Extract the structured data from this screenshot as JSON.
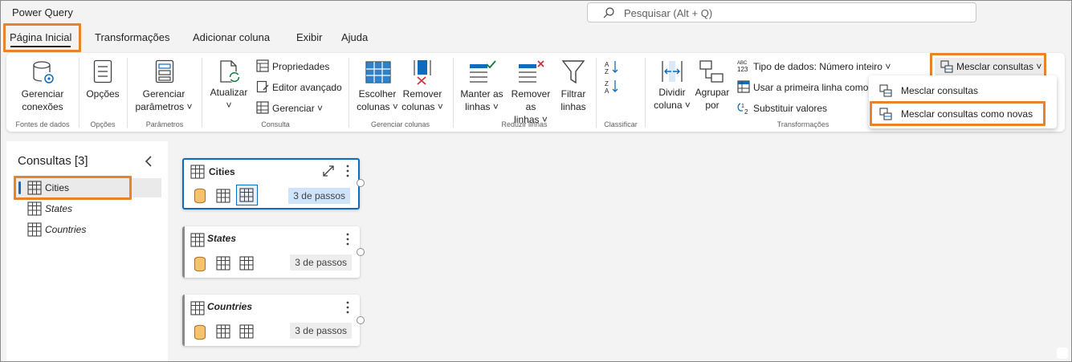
{
  "app": {
    "title": "Power Query"
  },
  "search": {
    "placeholder": "Pesquisar (Alt + Q)"
  },
  "tabs": [
    {
      "label": "Página Inicial",
      "active": true
    },
    {
      "label": "Transformações"
    },
    {
      "label": "Adicionar coluna"
    },
    {
      "label": "Exibir"
    },
    {
      "label": "Ajuda"
    }
  ],
  "ribbon": {
    "fontes": {
      "btn1": "Gerenciar",
      "btn2": "conexões",
      "group": "Fontes de dados"
    },
    "opcoes": {
      "btn": "Opções",
      "group": "Opções"
    },
    "parametros": {
      "btn1": "Gerenciar",
      "btn2": "parâmetros",
      "group": "Parâmetros"
    },
    "consulta": {
      "atualizar": "Atualizar",
      "propriedades": "Propriedades",
      "editor": "Editor avançado",
      "gerenciar": "Gerenciar",
      "group": "Consulta"
    },
    "colunas": {
      "escolher1": "Escolher",
      "escolher2": "colunas",
      "remover1": "Remover",
      "remover2": "colunas",
      "group": "Gerenciar colunas"
    },
    "linhas": {
      "manter1": "Manter as",
      "manter2": "linhas",
      "remover1": "Remover as",
      "remover2": "linhas",
      "filtrar1": "Filtrar",
      "filtrar2": "linhas",
      "group": "Reduzir linhas"
    },
    "classificar": {
      "group": "Classificar"
    },
    "transf": {
      "dividir1": "Dividir",
      "dividir2": "coluna",
      "agrupar1": "Agrupar",
      "agrupar2": "por",
      "tipo": "Tipo de dados: Número inteiro",
      "primeira": "Usar a primeira linha como",
      "substituir": "Substituir valores",
      "group": "Transformações"
    },
    "mesclar": {
      "label": "Mesclar consultas"
    }
  },
  "dropdown": {
    "items": [
      "Mesclar consultas",
      "Mesclar consultas como novas"
    ]
  },
  "panel": {
    "title": "Consultas [3]",
    "queries": [
      "Cities",
      "States",
      "Countries"
    ]
  },
  "cards": [
    {
      "title": "Cities",
      "steps": "3 de passos"
    },
    {
      "title": "States",
      "steps": "3 de passos"
    },
    {
      "title": "Countries",
      "steps": "3 de passos"
    }
  ],
  "colors": {
    "accent": "#0f6cbd",
    "highlight": "#e8832a"
  }
}
